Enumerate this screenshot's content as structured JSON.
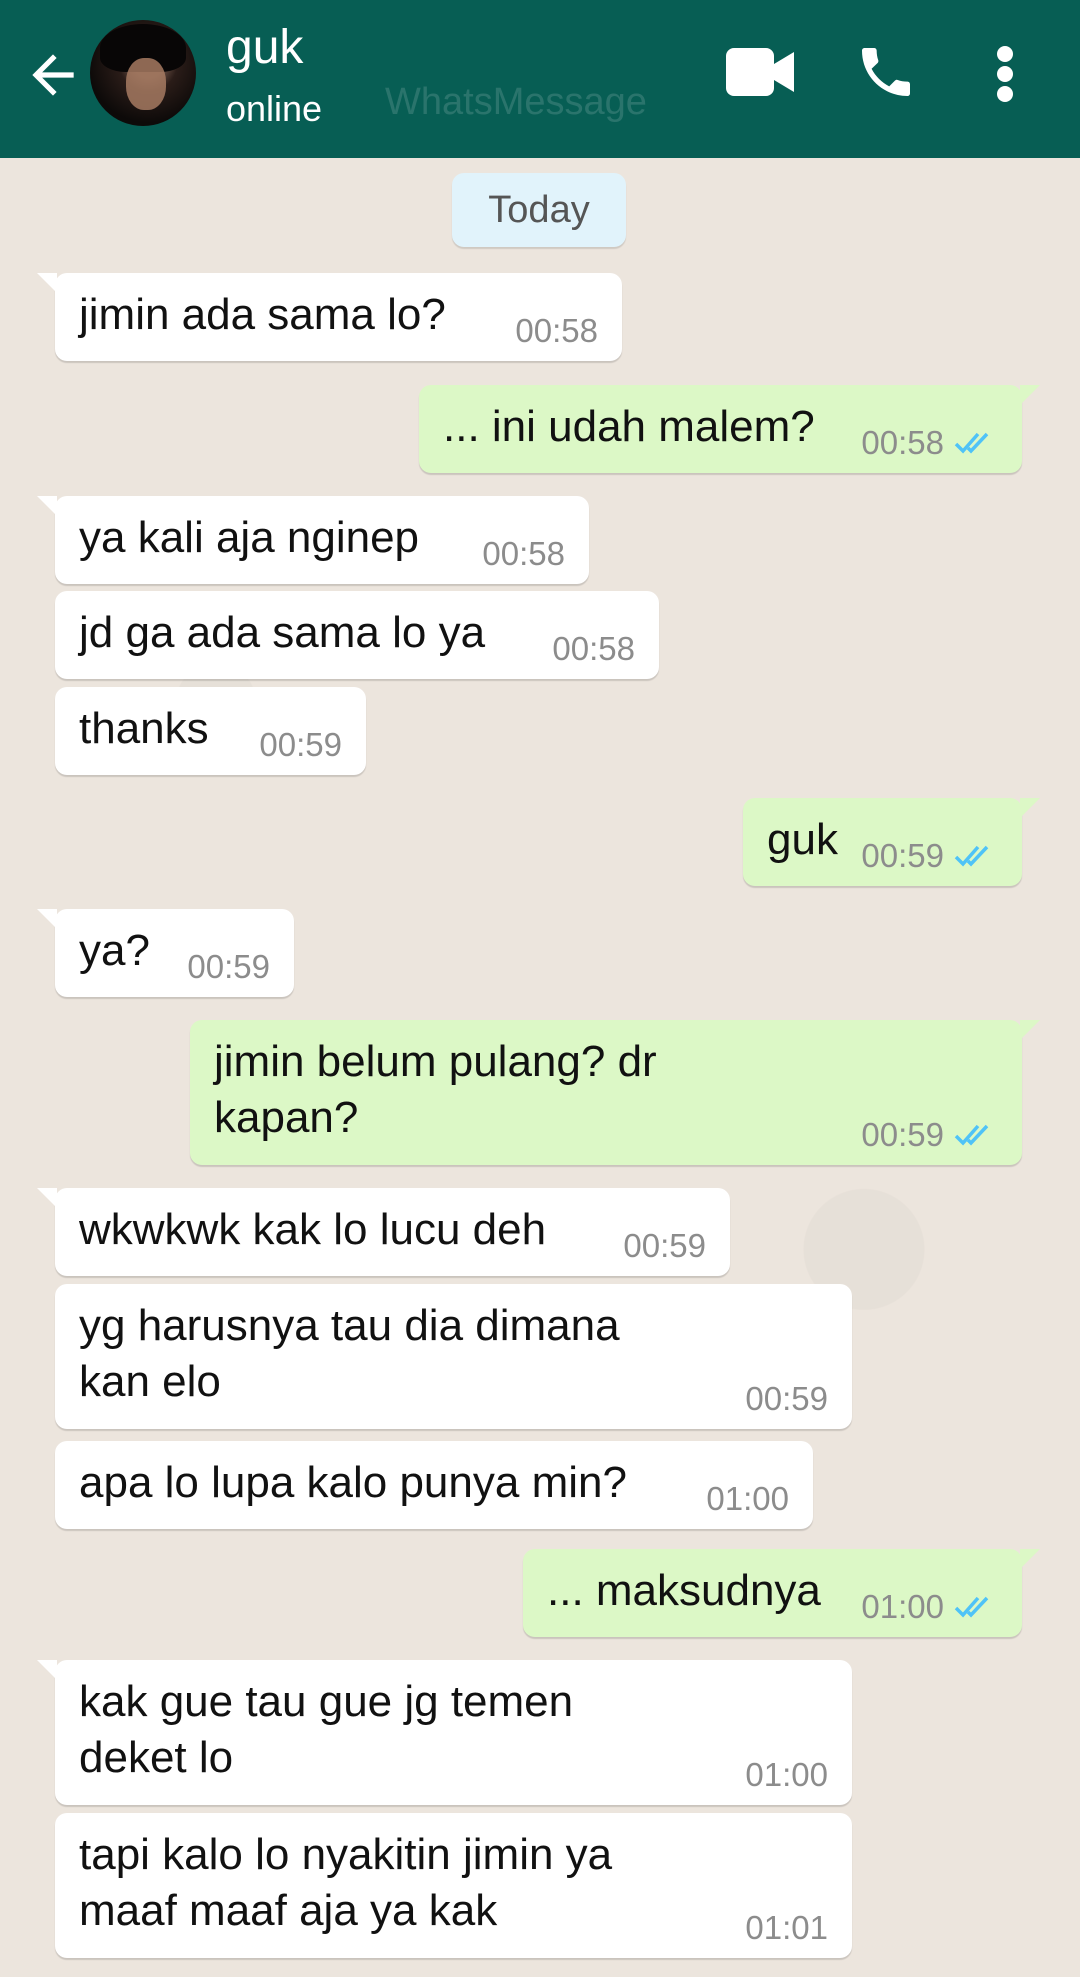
{
  "header": {
    "contact_name": "guk",
    "status": "online",
    "watermark": "WhatsMessage",
    "icons": [
      "back-arrow-icon",
      "avatar",
      "video-call-icon",
      "phone-icon",
      "more-vert-icon"
    ]
  },
  "chat": {
    "date_chip": "Today",
    "messages": [
      {
        "dir": "in",
        "text": "jimin ada sama lo?",
        "time": "00:58"
      },
      {
        "dir": "out",
        "text": "... ini udah malem?",
        "time": "00:58",
        "read": true
      },
      {
        "dir": "in",
        "text": "ya kali aja nginep",
        "time": "00:58"
      },
      {
        "dir": "in",
        "text": "jd ga ada sama lo ya",
        "time": "00:58"
      },
      {
        "dir": "in",
        "text": "thanks",
        "time": "00:59"
      },
      {
        "dir": "out",
        "text": "guk",
        "time": "00:59",
        "read": true
      },
      {
        "dir": "in",
        "text": "ya?",
        "time": "00:59"
      },
      {
        "dir": "out",
        "text": "jimin belum pulang? dr\nkapan?",
        "time": "00:59",
        "read": true
      },
      {
        "dir": "in",
        "text": "wkwkwk kak lo lucu deh",
        "time": "00:59"
      },
      {
        "dir": "in",
        "text": "yg harusnya tau dia dimana\nkan elo",
        "time": "00:59"
      },
      {
        "dir": "in",
        "text": "apa lo lupa kalo punya min?",
        "time": "01:00"
      },
      {
        "dir": "out",
        "text": "... maksudnya",
        "time": "01:00",
        "read": true
      },
      {
        "dir": "in",
        "text": "kak gue tau gue jg temen\ndeket lo",
        "time": "01:00"
      },
      {
        "dir": "in",
        "text": "tapi kalo lo nyakitin jimin ya\nmaaf maaf aja ya kak",
        "time": "01:01"
      }
    ]
  },
  "colors": {
    "header_bg": "#075e54",
    "chat_bg": "#ece5dd",
    "incoming_bubble": "#ffffff",
    "outgoing_bubble": "#dcf8c6",
    "date_chip_bg": "#e1f3fb",
    "read_tick": "#4fc3f7"
  }
}
